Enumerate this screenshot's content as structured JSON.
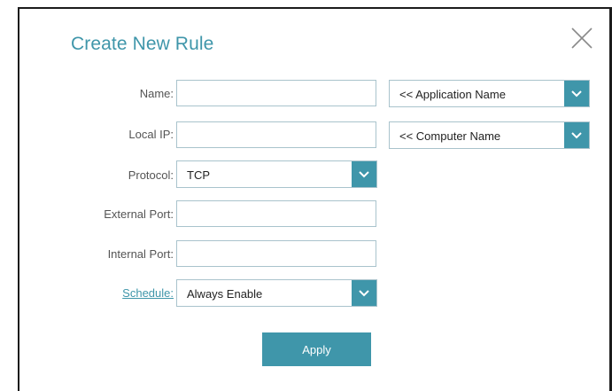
{
  "dialog": {
    "title": "Create New Rule",
    "close_icon": "close-icon"
  },
  "form": {
    "name_label": "Name:",
    "name_value": "",
    "application_select": "<< Application Name",
    "local_ip_label": "Local IP:",
    "local_ip_value": "",
    "computer_select": "<< Computer Name",
    "protocol_label": "Protocol:",
    "protocol_value": "TCP",
    "external_port_label": "External Port:",
    "external_port_value": "",
    "internal_port_label": "Internal Port:",
    "internal_port_value": "",
    "schedule_label": "Schedule:",
    "schedule_value": "Always Enable",
    "apply_label": "Apply"
  },
  "colors": {
    "accent": "#3f96aa",
    "border": "#a9c3cc",
    "label": "#545454"
  }
}
